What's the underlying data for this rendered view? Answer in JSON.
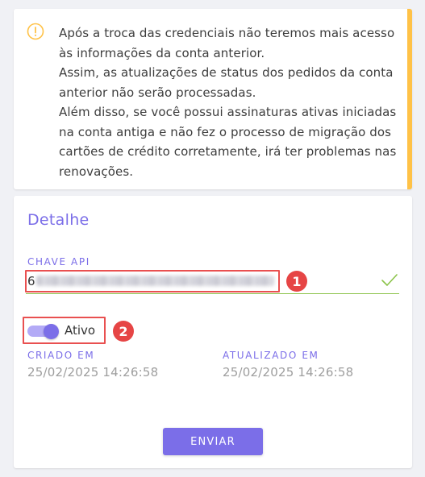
{
  "notice": {
    "icon": "warning-circle-icon",
    "accent_color": "#ffc247",
    "paragraphs": [
      "Após a troca das credenciais não teremos mais acesso às informações da conta anterior.",
      "Assim, as atualizações de status dos pedidos da conta anterior não serão processadas.",
      "Além disso, se você possui assinaturas ativas iniciadas na conta antiga e não fez o processo de migração dos cartões de crédito corretamente, irá ter problemas nas renovações."
    ]
  },
  "detail": {
    "title": "Detalhe",
    "api_key": {
      "label": "CHAVE API",
      "value": "6",
      "value_blurred": true,
      "valid": true,
      "valid_icon": "check-icon",
      "valid_color": "#8bc34a"
    },
    "status": {
      "label": "Ativo",
      "enabled": true
    },
    "created": {
      "label": "CRIADO EM",
      "value": "25/02/2025 14:26:58"
    },
    "updated": {
      "label": "ATUALIZADO EM",
      "value": "25/02/2025 14:26:58"
    },
    "submit_label": "ENVIAR"
  },
  "annotations": {
    "step_1": "1",
    "step_2": "2",
    "color": "#e64545"
  },
  "theme": {
    "primary": "#7b6ee8",
    "primary_light": "#b3aaf6"
  }
}
